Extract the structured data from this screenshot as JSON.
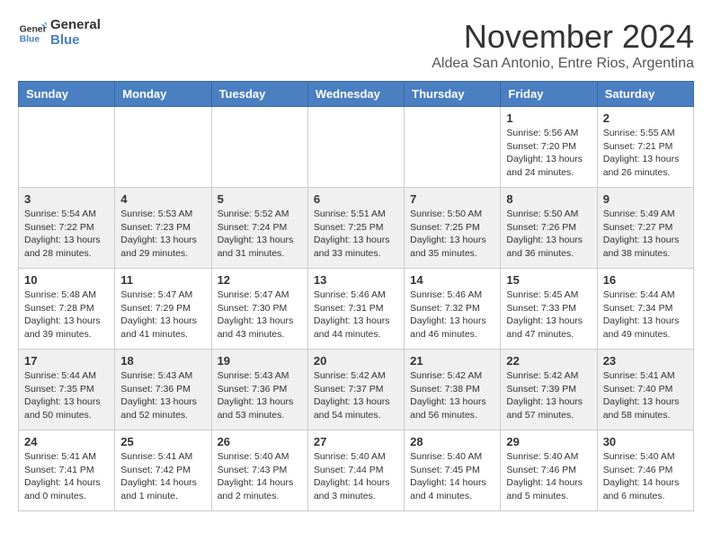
{
  "header": {
    "logo_line1": "General",
    "logo_line2": "Blue",
    "month_title": "November 2024",
    "subtitle": "Aldea San Antonio, Entre Rios, Argentina"
  },
  "weekdays": [
    "Sunday",
    "Monday",
    "Tuesday",
    "Wednesday",
    "Thursday",
    "Friday",
    "Saturday"
  ],
  "weeks": [
    {
      "days": [
        {
          "num": "",
          "info": ""
        },
        {
          "num": "",
          "info": ""
        },
        {
          "num": "",
          "info": ""
        },
        {
          "num": "",
          "info": ""
        },
        {
          "num": "",
          "info": ""
        },
        {
          "num": "1",
          "info": "Sunrise: 5:56 AM\nSunset: 7:20 PM\nDaylight: 13 hours\nand 24 minutes."
        },
        {
          "num": "2",
          "info": "Sunrise: 5:55 AM\nSunset: 7:21 PM\nDaylight: 13 hours\nand 26 minutes."
        }
      ]
    },
    {
      "days": [
        {
          "num": "3",
          "info": "Sunrise: 5:54 AM\nSunset: 7:22 PM\nDaylight: 13 hours\nand 28 minutes."
        },
        {
          "num": "4",
          "info": "Sunrise: 5:53 AM\nSunset: 7:23 PM\nDaylight: 13 hours\nand 29 minutes."
        },
        {
          "num": "5",
          "info": "Sunrise: 5:52 AM\nSunset: 7:24 PM\nDaylight: 13 hours\nand 31 minutes."
        },
        {
          "num": "6",
          "info": "Sunrise: 5:51 AM\nSunset: 7:25 PM\nDaylight: 13 hours\nand 33 minutes."
        },
        {
          "num": "7",
          "info": "Sunrise: 5:50 AM\nSunset: 7:25 PM\nDaylight: 13 hours\nand 35 minutes."
        },
        {
          "num": "8",
          "info": "Sunrise: 5:50 AM\nSunset: 7:26 PM\nDaylight: 13 hours\nand 36 minutes."
        },
        {
          "num": "9",
          "info": "Sunrise: 5:49 AM\nSunset: 7:27 PM\nDaylight: 13 hours\nand 38 minutes."
        }
      ]
    },
    {
      "days": [
        {
          "num": "10",
          "info": "Sunrise: 5:48 AM\nSunset: 7:28 PM\nDaylight: 13 hours\nand 39 minutes."
        },
        {
          "num": "11",
          "info": "Sunrise: 5:47 AM\nSunset: 7:29 PM\nDaylight: 13 hours\nand 41 minutes."
        },
        {
          "num": "12",
          "info": "Sunrise: 5:47 AM\nSunset: 7:30 PM\nDaylight: 13 hours\nand 43 minutes."
        },
        {
          "num": "13",
          "info": "Sunrise: 5:46 AM\nSunset: 7:31 PM\nDaylight: 13 hours\nand 44 minutes."
        },
        {
          "num": "14",
          "info": "Sunrise: 5:46 AM\nSunset: 7:32 PM\nDaylight: 13 hours\nand 46 minutes."
        },
        {
          "num": "15",
          "info": "Sunrise: 5:45 AM\nSunset: 7:33 PM\nDaylight: 13 hours\nand 47 minutes."
        },
        {
          "num": "16",
          "info": "Sunrise: 5:44 AM\nSunset: 7:34 PM\nDaylight: 13 hours\nand 49 minutes."
        }
      ]
    },
    {
      "days": [
        {
          "num": "17",
          "info": "Sunrise: 5:44 AM\nSunset: 7:35 PM\nDaylight: 13 hours\nand 50 minutes."
        },
        {
          "num": "18",
          "info": "Sunrise: 5:43 AM\nSunset: 7:36 PM\nDaylight: 13 hours\nand 52 minutes."
        },
        {
          "num": "19",
          "info": "Sunrise: 5:43 AM\nSunset: 7:36 PM\nDaylight: 13 hours\nand 53 minutes."
        },
        {
          "num": "20",
          "info": "Sunrise: 5:42 AM\nSunset: 7:37 PM\nDaylight: 13 hours\nand 54 minutes."
        },
        {
          "num": "21",
          "info": "Sunrise: 5:42 AM\nSunset: 7:38 PM\nDaylight: 13 hours\nand 56 minutes."
        },
        {
          "num": "22",
          "info": "Sunrise: 5:42 AM\nSunset: 7:39 PM\nDaylight: 13 hours\nand 57 minutes."
        },
        {
          "num": "23",
          "info": "Sunrise: 5:41 AM\nSunset: 7:40 PM\nDaylight: 13 hours\nand 58 minutes."
        }
      ]
    },
    {
      "days": [
        {
          "num": "24",
          "info": "Sunrise: 5:41 AM\nSunset: 7:41 PM\nDaylight: 14 hours\nand 0 minutes."
        },
        {
          "num": "25",
          "info": "Sunrise: 5:41 AM\nSunset: 7:42 PM\nDaylight: 14 hours\nand 1 minute."
        },
        {
          "num": "26",
          "info": "Sunrise: 5:40 AM\nSunset: 7:43 PM\nDaylight: 14 hours\nand 2 minutes."
        },
        {
          "num": "27",
          "info": "Sunrise: 5:40 AM\nSunset: 7:44 PM\nDaylight: 14 hours\nand 3 minutes."
        },
        {
          "num": "28",
          "info": "Sunrise: 5:40 AM\nSunset: 7:45 PM\nDaylight: 14 hours\nand 4 minutes."
        },
        {
          "num": "29",
          "info": "Sunrise: 5:40 AM\nSunset: 7:46 PM\nDaylight: 14 hours\nand 5 minutes."
        },
        {
          "num": "30",
          "info": "Sunrise: 5:40 AM\nSunset: 7:46 PM\nDaylight: 14 hours\nand 6 minutes."
        }
      ]
    }
  ]
}
